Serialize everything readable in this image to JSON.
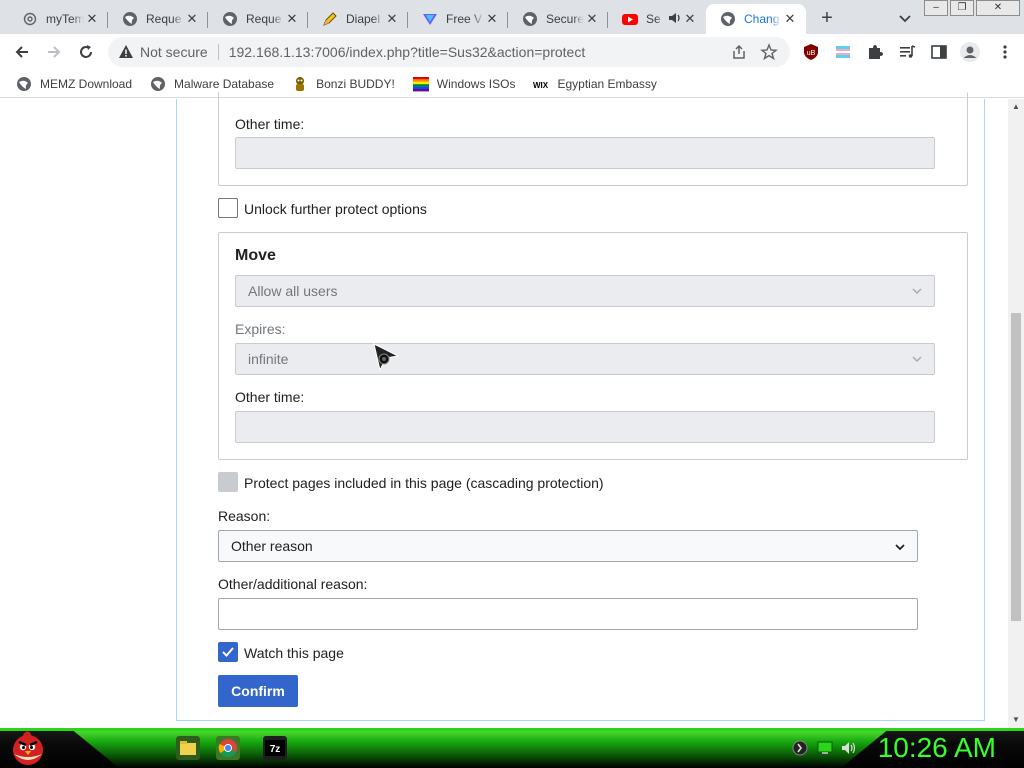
{
  "tabs": [
    {
      "title": "myTem",
      "icon": "at-icon"
    },
    {
      "title": "Reque",
      "icon": "globe-icon"
    },
    {
      "title": "Reque",
      "icon": "globe-icon"
    },
    {
      "title": "Diapel",
      "icon": "pencil-icon"
    },
    {
      "title": "Free V",
      "icon": "vpn-icon"
    },
    {
      "title": "Secure",
      "icon": "globe-icon"
    },
    {
      "title": "Se",
      "icon": "youtube-icon"
    },
    {
      "title": "Chang",
      "icon": "globe-icon",
      "active": true
    }
  ],
  "address_bar": {
    "security_label": "Not secure",
    "url": "192.168.1.13:7006/index.php?title=Sus32&action=protect"
  },
  "bookmarks": [
    {
      "label": "MEMZ Download",
      "icon": "globe-icon"
    },
    {
      "label": "Malware Database",
      "icon": "globe-icon"
    },
    {
      "label": "Bonzi BUDDY!",
      "icon": "bonzi-icon"
    },
    {
      "label": "Windows ISOs",
      "icon": "windows-flag-icon"
    },
    {
      "label": "Egyptian Embassy",
      "icon": "wix-icon"
    }
  ],
  "form": {
    "other_time_label_1": "Other time:",
    "unlock_label": "Unlock further protect options",
    "move": {
      "legend": "Move",
      "level_value": "Allow all users",
      "expires_label": "Expires:",
      "expires_value": "infinite",
      "other_time_label": "Other time:"
    },
    "cascade_label": "Protect pages included in this page (cascading protection)",
    "reason_label": "Reason:",
    "reason_value": "Other reason",
    "additional_reason_label": "Other/additional reason:",
    "watch_label": "Watch this page",
    "watch_checked": true,
    "confirm_label": "Confirm"
  },
  "taskbar": {
    "clock": "10:26 AM"
  },
  "colors": {
    "accent": "#3366cc",
    "clock_green": "#36ff29",
    "taskbar_glow": "#18b80f"
  }
}
